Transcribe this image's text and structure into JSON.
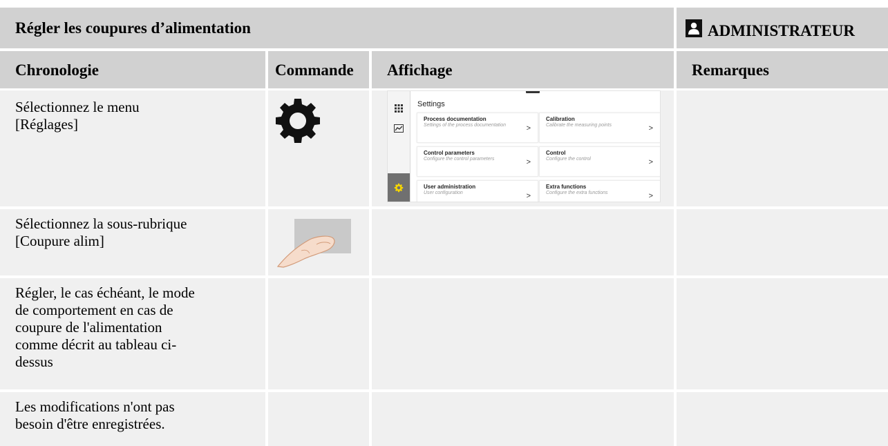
{
  "header": {
    "title": "Régler les coupures d’alimentation",
    "role": "ADMINISTRATEUR",
    "role_icon": "user-icon"
  },
  "columns": [
    "Chronologie",
    "Commande",
    "Affichage",
    "Remarques"
  ],
  "rows": [
    {
      "step": "Sélectionnez le menu\n[Réglages]",
      "command_icon": "gear-icon"
    },
    {
      "step": "Sélectionnez la sous-rubrique\n[Coupure alim]",
      "command_icon": "finger-tap-icon"
    },
    {
      "step": "Régler, le cas échéant, le mode\nde comportement en cas de\ncoupure de l'alimentation\ncomme décrit au tableau ci-\ndessus",
      "command_icon": ""
    },
    {
      "step": "Les modifications n'ont pas\nbesoin d'être enregistrées.",
      "command_icon": ""
    }
  ],
  "screen": {
    "title": "Settings",
    "tiles": [
      {
        "title": "Process documentation",
        "sub": "Settings of the process documentation"
      },
      {
        "title": "Calibration",
        "sub": "Calibrate the measuring points"
      },
      {
        "title": "Control parameters",
        "sub": "Configure the control parameters"
      },
      {
        "title": "Control",
        "sub": "Configure the control"
      },
      {
        "title": "User administration",
        "sub": "User configuration"
      },
      {
        "title": "Extra functions",
        "sub": "Configure the extra functions"
      }
    ],
    "arrow": ">",
    "sidebar_icons": [
      "grid-icon",
      "chart-icon",
      "gear-icon"
    ],
    "accent": "#f7d700"
  },
  "colors": {
    "header_bg": "#d1d1d1",
    "cell_bg": "#f0f0f0"
  }
}
